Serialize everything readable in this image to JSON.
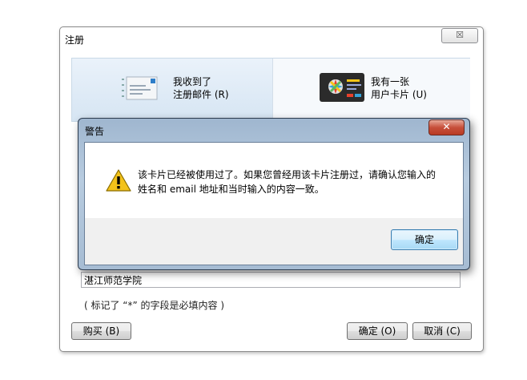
{
  "main_window": {
    "title": "注册",
    "close_glyph": "☒",
    "options": [
      {
        "line1": "我收到了",
        "line2": "注册邮件 (R)",
        "icon": "mail-icon"
      },
      {
        "line1": "我有一张",
        "line2": "用户卡片 (U)",
        "icon": "card-icon"
      }
    ],
    "org_value": "湛江师范学院",
    "required_note": "( 标记了 “*” 的字段是必填内容 )",
    "buttons": {
      "buy": "购买 (B)",
      "ok": "确定 (O)",
      "cancel": "取消 (C)"
    }
  },
  "warning_dialog": {
    "title": "警告",
    "close_glyph": "✕",
    "icon": "warning-icon",
    "message_line1": "该卡片已经被使用过了。如果您曾经用该卡片注册过，请确认您输入的",
    "message_line2": "姓名和 email 地址和当时输入的内容一致。",
    "ok_label": "确定"
  }
}
